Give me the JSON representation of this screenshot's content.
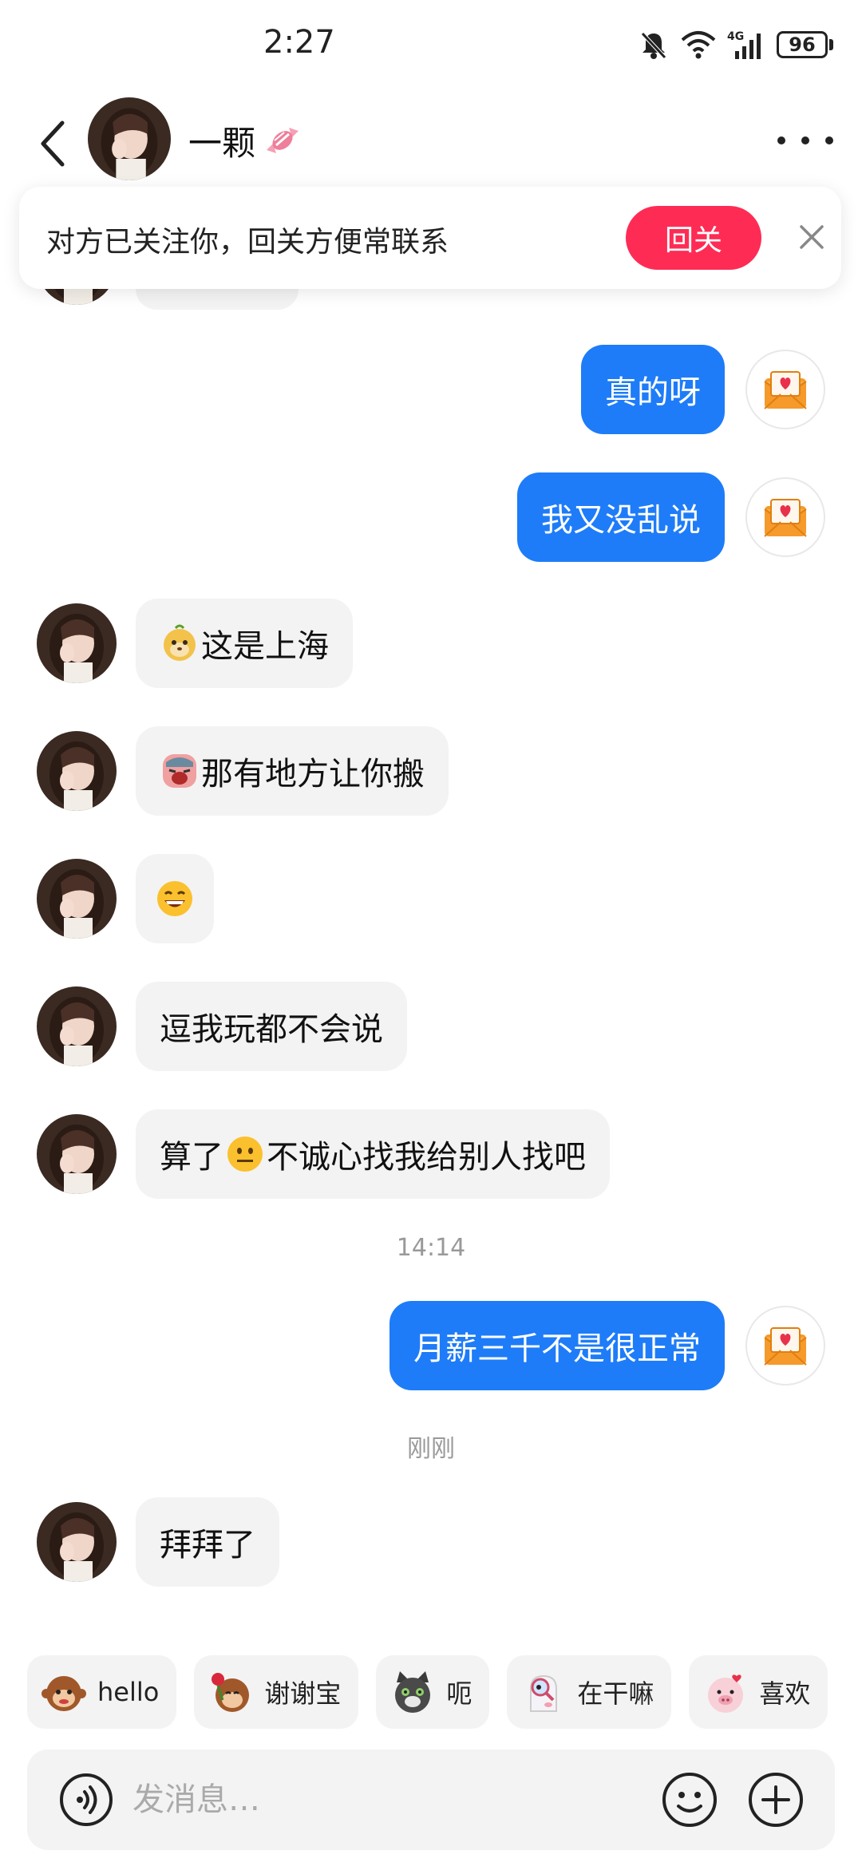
{
  "status_bar": {
    "time": "2:27",
    "battery": "96",
    "network": "4G"
  },
  "header": {
    "contact_name": "一颗"
  },
  "follow_banner": {
    "text": "对方已关注你，回关方便常联系",
    "button_label": "回关"
  },
  "messages": [
    {
      "dir": "out",
      "text": "真的呀"
    },
    {
      "dir": "out",
      "text": "我又没乱说"
    },
    {
      "dir": "in",
      "emoji": "meerkat-sticker",
      "text": "这是上海"
    },
    {
      "dir": "in",
      "emoji": "crying-face",
      "text": "那有地方让你搬"
    },
    {
      "dir": "in",
      "emoji": "grinning-face",
      "text": ""
    },
    {
      "dir": "in",
      "text": "逗我玩都不会说"
    },
    {
      "dir": "in",
      "text_before": "算了",
      "emoji": "neutral-face",
      "text_after": "不诚心找我给别人找吧"
    },
    {
      "dir": "time",
      "text": "14:14"
    },
    {
      "dir": "out",
      "text": "月薪三千不是很正常"
    },
    {
      "dir": "time",
      "text": "刚刚"
    },
    {
      "dir": "in",
      "text": "拜拜了"
    }
  ],
  "quick_replies": [
    {
      "label": "hello",
      "icon": "monkey-wave-icon"
    },
    {
      "label": "谢谢宝",
      "icon": "monkey-rose-icon"
    },
    {
      "label": "呃",
      "icon": "cat-icon"
    },
    {
      "label": "在干嘛",
      "icon": "magnifier-ghost-icon"
    },
    {
      "label": "喜欢",
      "icon": "pig-heart-icon"
    }
  ],
  "input": {
    "placeholder": "发消息…"
  },
  "colors": {
    "accent_blue": "#1e7cf8",
    "follow_red": "#fe2c55",
    "bubble_gray": "#f3f3f3"
  }
}
